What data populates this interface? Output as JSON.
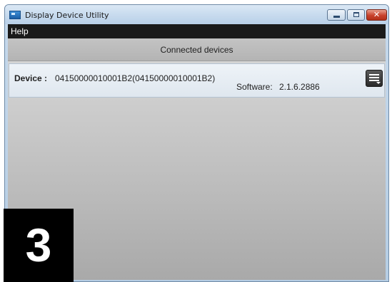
{
  "window": {
    "title": "Display Device Utility",
    "icon": "app-icon",
    "close_glyph": "✕"
  },
  "menu": {
    "help_label": "Help"
  },
  "panel": {
    "header": "Connected devices"
  },
  "device": {
    "label": "Device :",
    "value": "04150000010001B2(04150000010001B2)",
    "software_label": "Software:",
    "software_value": "2.1.6.2886",
    "menu_icon": "hamburger-menu-icon"
  },
  "overlay": {
    "step_number": "3"
  },
  "colors": {
    "menubar": "#1a1a1a",
    "close_button": "#c8412b",
    "badge": "#000000"
  }
}
